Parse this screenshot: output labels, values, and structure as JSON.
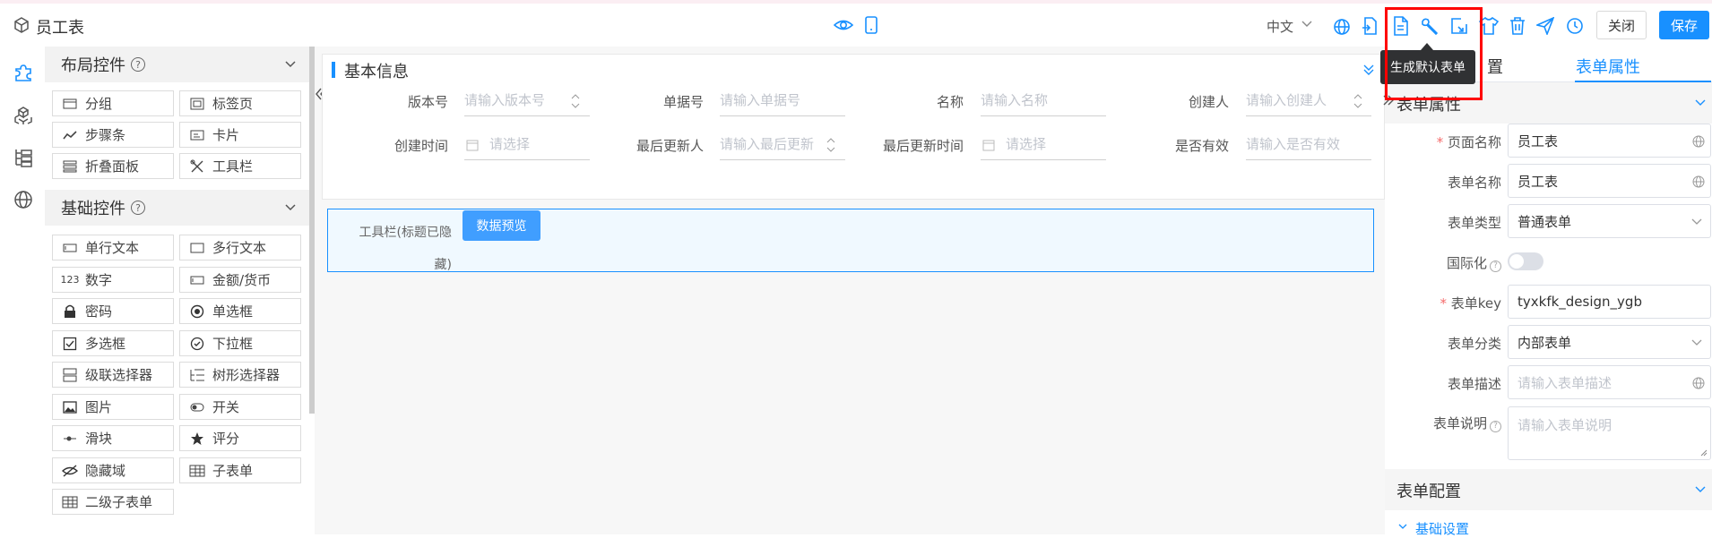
{
  "header": {
    "title": "员工表",
    "language": "中文",
    "close_label": "关闭",
    "save_label": "保存",
    "tooltip": "生成默认表单"
  },
  "palette": {
    "layout_title": "布局控件",
    "layout_items": [
      "分组",
      "标签页",
      "步骤条",
      "卡片",
      "折叠面板",
      "工具栏"
    ],
    "basic_title": "基础控件",
    "basic_items": [
      "单行文本",
      "多行文本",
      "数字",
      "金额/货币",
      "密码",
      "单选框",
      "多选框",
      "下拉框",
      "级联选择器",
      "树形选择器",
      "图片",
      "开关",
      "滑块",
      "评分",
      "隐藏域",
      "子表单",
      "二级子表单"
    ],
    "number_glyph": "123"
  },
  "canvas": {
    "section_title": "基本信息",
    "fields": [
      {
        "label": "版本号",
        "placeholder": "请输入版本号"
      },
      {
        "label": "单据号",
        "placeholder": "请输入单据号"
      },
      {
        "label": "名称",
        "placeholder": "请输入名称"
      },
      {
        "label": "创建人",
        "placeholder": "请输入创建人"
      },
      {
        "label": "创建时间",
        "placeholder": "请选择"
      },
      {
        "label": "最后更新人",
        "placeholder": "请输入最后更新"
      },
      {
        "label": "最后更新时间",
        "placeholder": "请选择"
      },
      {
        "label": "是否有效",
        "placeholder": "请输入是否有效"
      }
    ],
    "toolbar_label_1": "工具栏(标题已隐",
    "toolbar_label_2": "藏)",
    "preview_button": "数据预览"
  },
  "properties": {
    "tab_partial": "置",
    "tab_active": "表单属性",
    "section_title": "表单属性",
    "rows": [
      {
        "label": "页面名称",
        "required": "*",
        "value": "员工表"
      },
      {
        "label": "表单名称",
        "value": "员工表"
      },
      {
        "label": "表单类型",
        "value": "普通表单"
      },
      {
        "label": "国际化"
      },
      {
        "label": "表单key",
        "required": "*",
        "value": "tyxkfk_design_ygb"
      },
      {
        "label": "表单分类",
        "value": "内部表单"
      },
      {
        "label": "表单描述",
        "placeholder": "请输入表单描述"
      },
      {
        "label": "表单说明",
        "placeholder": "请输入表单说明"
      }
    ],
    "config_title": "表单配置",
    "basic_settings": "基础设置"
  },
  "colors": {
    "accent": "#1890ff",
    "highlight": "#ff0000",
    "tooltip_bg": "#303133"
  }
}
